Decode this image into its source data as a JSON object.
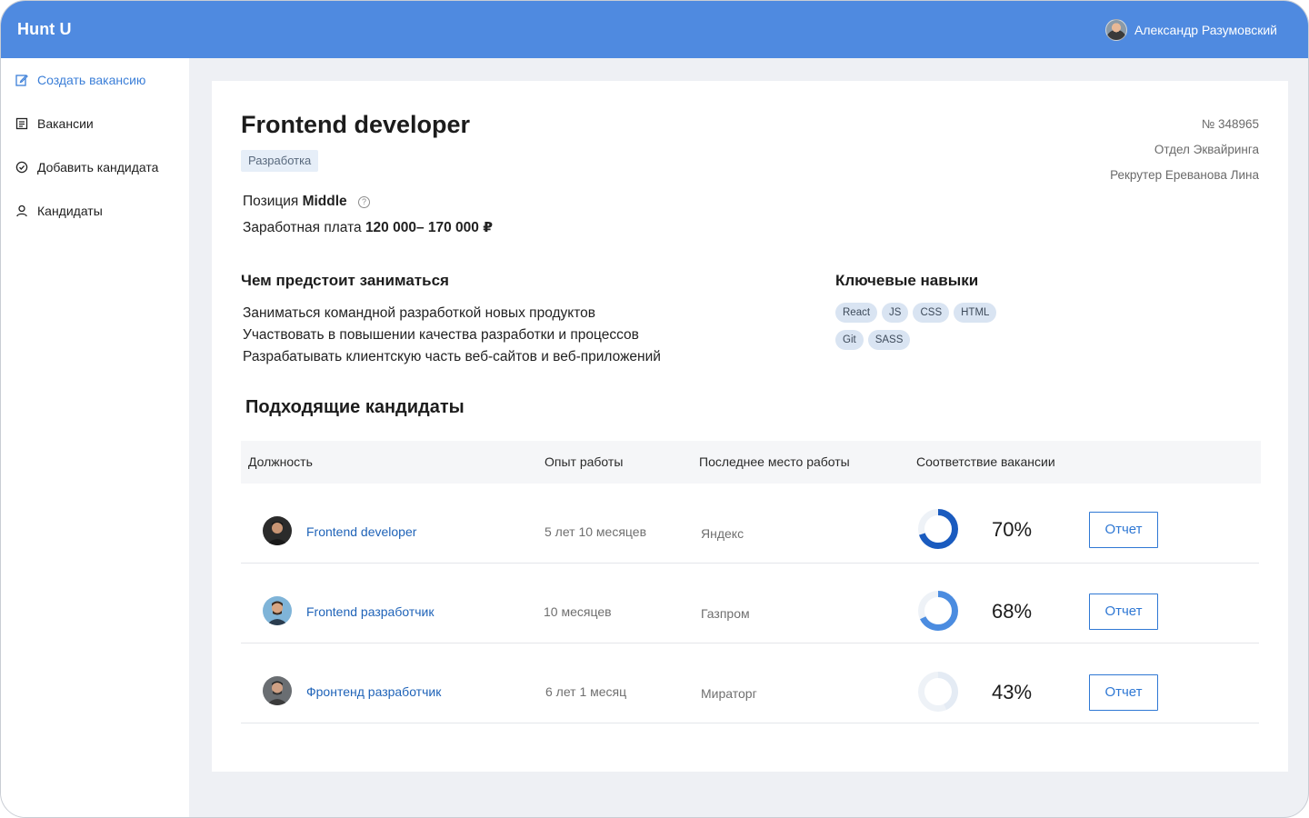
{
  "app": {
    "brand": "Hunt U",
    "user_name": "Александр Разумовский"
  },
  "sidebar": {
    "items": [
      {
        "label": "Создать вакансию",
        "icon": "edit-icon",
        "active": true
      },
      {
        "label": "Вакансии",
        "icon": "list-icon",
        "active": false
      },
      {
        "label": "Добавить кандидата",
        "icon": "check-circle-icon",
        "active": false
      },
      {
        "label": "Кандидаты",
        "icon": "user-icon",
        "active": false
      }
    ]
  },
  "vacancy": {
    "title": "Frontend developer",
    "tag": "Разработка",
    "number": "№ 348965",
    "department": "Отдел Эквайринга",
    "recruiter": "Рекрутер Ереванова Лина",
    "position_label": "Позиция",
    "position_value": "Middle",
    "salary_label": "Заработная плата",
    "salary_value": "120 000– 170 000 ₽",
    "duties_title": "Чем предстоит заниматься",
    "duties": [
      "Заниматься командной разработкой новых продуктов",
      "Участвовать в повышении качества разработки и процессов",
      "Разрабатывать клиентскую часть веб-сайтов и веб-приложений"
    ],
    "skills_title": "Ключевые навыки",
    "skills": [
      "React",
      "JS",
      "CSS",
      "HTML",
      "Git",
      "SASS"
    ]
  },
  "candidates": {
    "title": "Подходящие кандидаты",
    "columns": [
      "Должность",
      "Опыт работы",
      "Последнее место работы",
      "Соответствие вакансии"
    ],
    "rows": [
      {
        "position": "Frontend developer",
        "experience": "5 лет 10 месяцев",
        "last_job": "Яндекс",
        "match": 70,
        "match_label": "70%",
        "button": "Отчет",
        "donut_color": "#1a5bbf"
      },
      {
        "position": "Frontend разработчик",
        "experience": "10 месяцев",
        "last_job": "Газпром",
        "match": 68,
        "match_label": "68%",
        "button": "Отчет",
        "donut_color": "#4b8ce0"
      },
      {
        "position": "Фронтенд разработчик",
        "experience": "6 лет 1 месяц",
        "last_job": "Мираторг",
        "match": 43,
        "match_label": "43%",
        "button": "Отчет",
        "donut_color": "#e4ebf4"
      }
    ]
  },
  "colors": {
    "topbar": "#4f8ae0",
    "accent": "#2f78d4",
    "donut_track": "#eef2f7"
  }
}
